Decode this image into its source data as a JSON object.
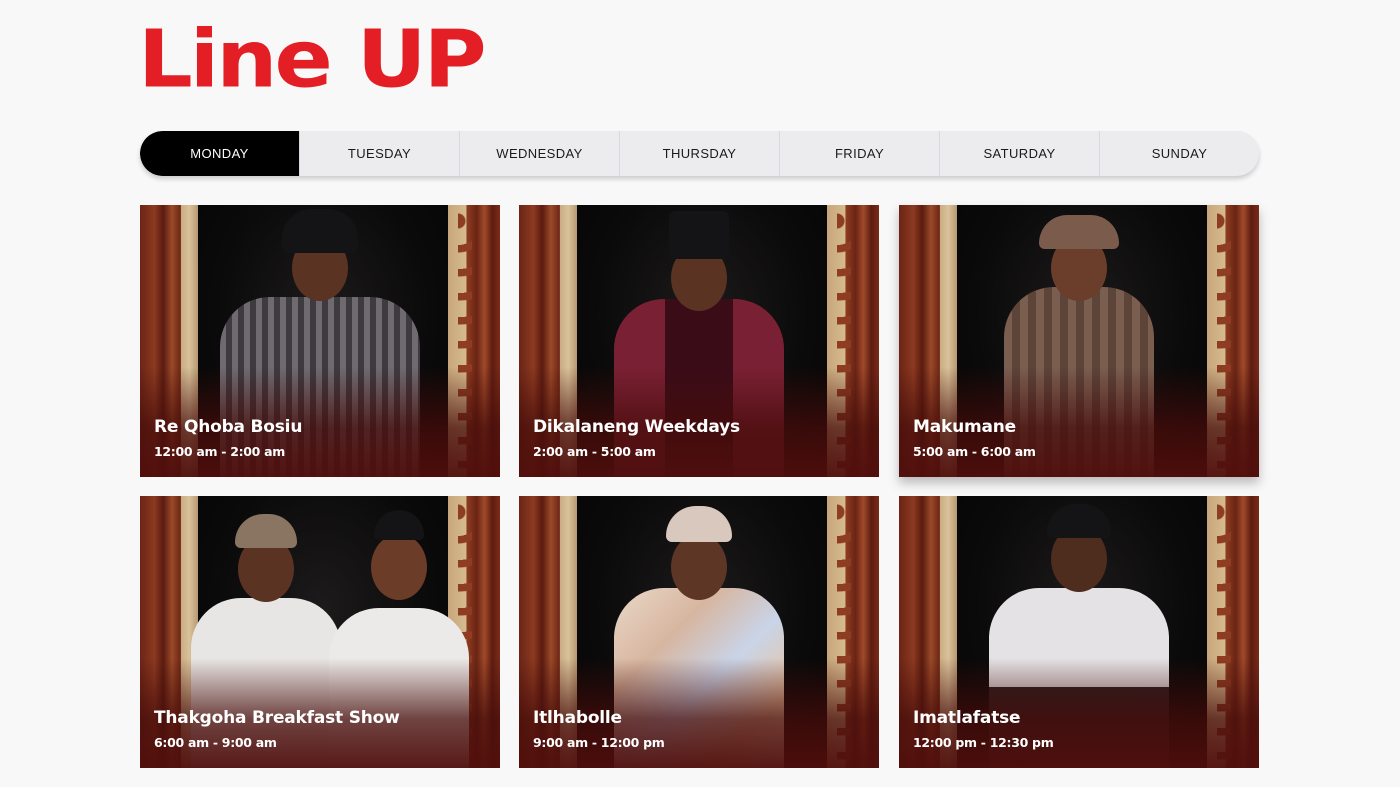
{
  "page": {
    "title": "Line UP"
  },
  "days": [
    {
      "label": "MONDAY",
      "active": true
    },
    {
      "label": "TUESDAY",
      "active": false
    },
    {
      "label": "WEDNESDAY",
      "active": false
    },
    {
      "label": "THURSDAY",
      "active": false
    },
    {
      "label": "FRIDAY",
      "active": false
    },
    {
      "label": "SATURDAY",
      "active": false
    },
    {
      "label": "SUNDAY",
      "active": false
    }
  ],
  "colors": {
    "brand": "#e31e25",
    "active_tab": "#000000",
    "tab_bar": "#ececef"
  },
  "shows": [
    {
      "name": "Re Qhoba Bosiu",
      "time": "12:00 am - 2:00 am"
    },
    {
      "name": "Dikalaneng Weekdays",
      "time": "2:00 am - 5:00 am"
    },
    {
      "name": "Makumane",
      "time": "5:00 am - 6:00 am"
    },
    {
      "name": "Thakgoha Breakfast Show",
      "time": "6:00 am - 9:00 am"
    },
    {
      "name": "Itlhabolle",
      "time": "9:00 am - 12:00 pm"
    },
    {
      "name": "Imatlafatse",
      "time": "12:00 pm - 12:30 pm"
    }
  ]
}
